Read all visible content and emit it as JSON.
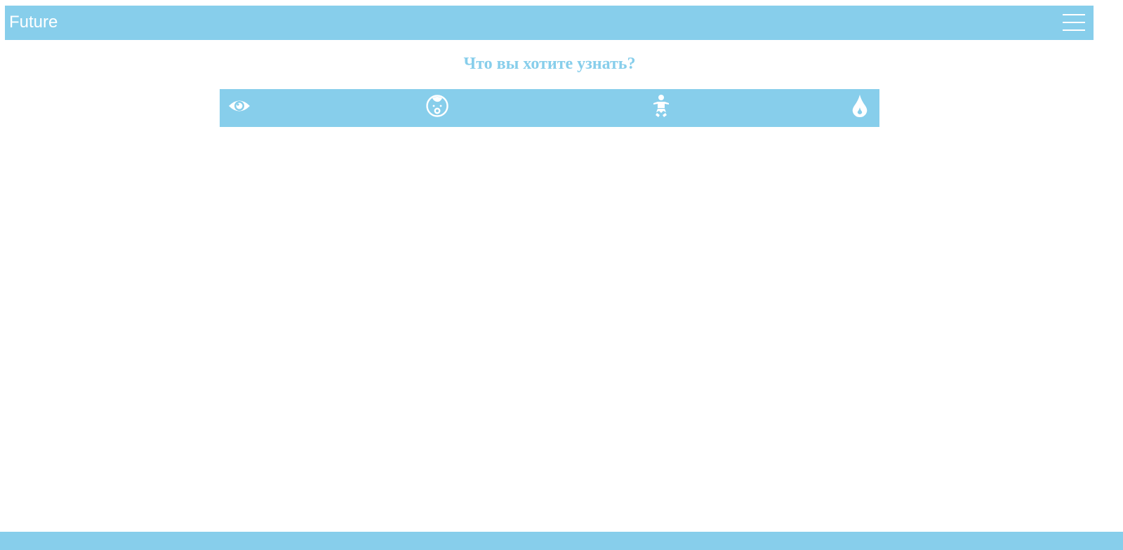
{
  "header": {
    "brand": "Future",
    "menu_icon": "hamburger-menu-icon"
  },
  "main": {
    "question": "Что вы хотите узнать?",
    "options": [
      {
        "icon": "eye-icon"
      },
      {
        "icon": "baby-face-icon"
      },
      {
        "icon": "baby-diaper-icon"
      },
      {
        "icon": "drop-icon"
      }
    ]
  },
  "colors": {
    "accent": "#87ceeb",
    "text_on_accent": "#ffffff",
    "background": "#ffffff"
  }
}
